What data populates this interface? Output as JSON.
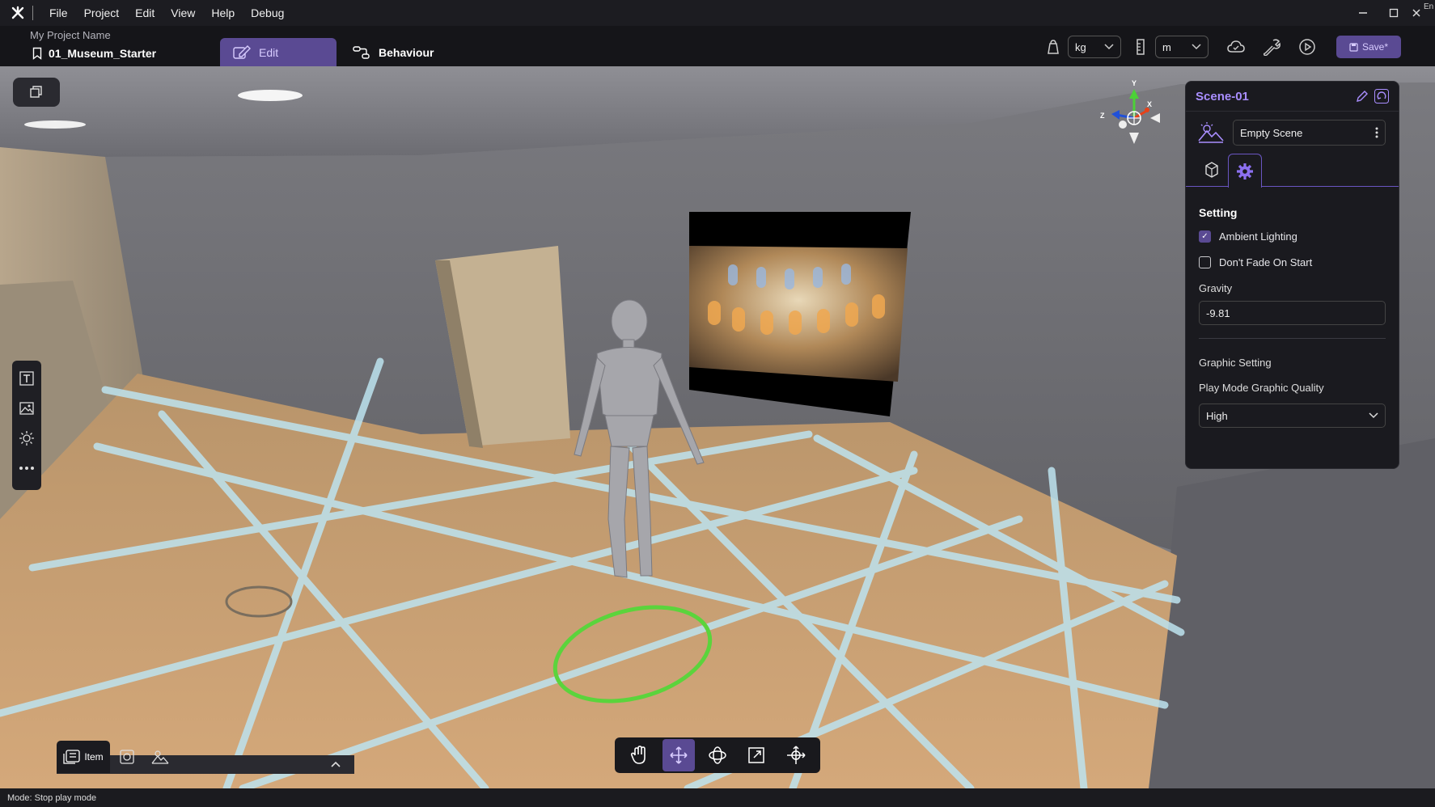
{
  "menubar": {
    "items": [
      "File",
      "Project",
      "Edit",
      "View",
      "Help",
      "Debug"
    ]
  },
  "window": {
    "corner_label": "En"
  },
  "toolbar": {
    "project_name": "My Project Name",
    "scene_file": "01_Museum_Starter",
    "edit_tab": "Edit",
    "behaviour_tab": "Behaviour",
    "mass_unit": "kg",
    "length_unit": "m",
    "save_label": "Save*"
  },
  "gizmo": {
    "y_label": "Y",
    "x_label": "X",
    "z_label": "Z"
  },
  "panel": {
    "title": "Scene-01",
    "scene_select": "Empty Scene",
    "section_title": "Setting",
    "ambient_lighting_label": "Ambient Lighting",
    "ambient_lighting_checked": true,
    "dont_fade_label": "Don't Fade On Start",
    "dont_fade_checked": false,
    "gravity_label": "Gravity",
    "gravity_value": "-9.81",
    "graphic_setting_label": "Graphic Setting",
    "quality_label": "Play Mode Graphic Quality",
    "quality_value": "High"
  },
  "dock": {
    "item_tab": "Item"
  },
  "status": {
    "text": "Mode: Stop play mode"
  },
  "colors": {
    "accent": "#5a4a93",
    "accent_text": "#a98eff",
    "bg_dark": "#1a1a1f"
  }
}
